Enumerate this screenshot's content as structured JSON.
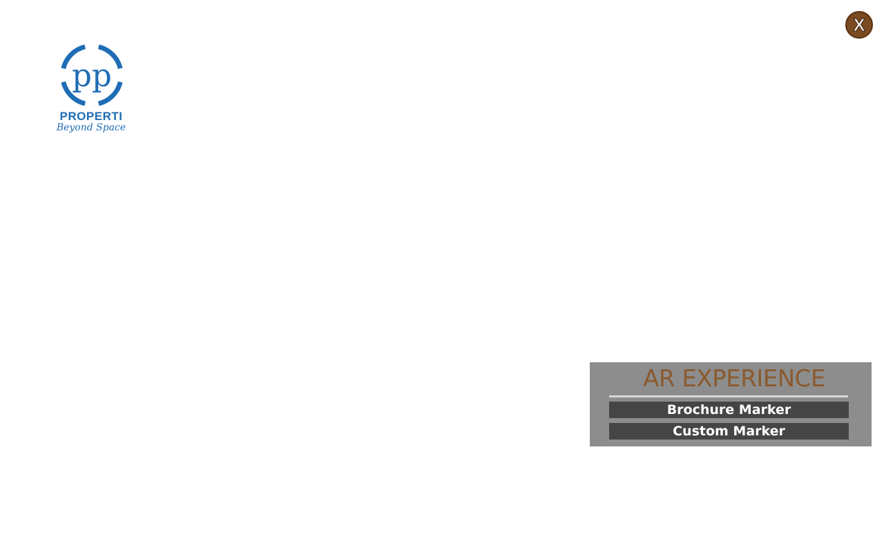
{
  "logo": {
    "monogram": "pp",
    "word": "PROPERTI",
    "tagline": "Beyond Space",
    "color": "#1f6db5"
  },
  "close_button": {
    "label": "X",
    "color": "#7a4a22",
    "icon": "close-icon"
  },
  "ar_panel": {
    "title": "AR EXPERIENCE",
    "title_color": "#8a5a2f",
    "buttons": [
      {
        "label": "Brochure Marker"
      },
      {
        "label": "Custom Marker"
      }
    ]
  }
}
